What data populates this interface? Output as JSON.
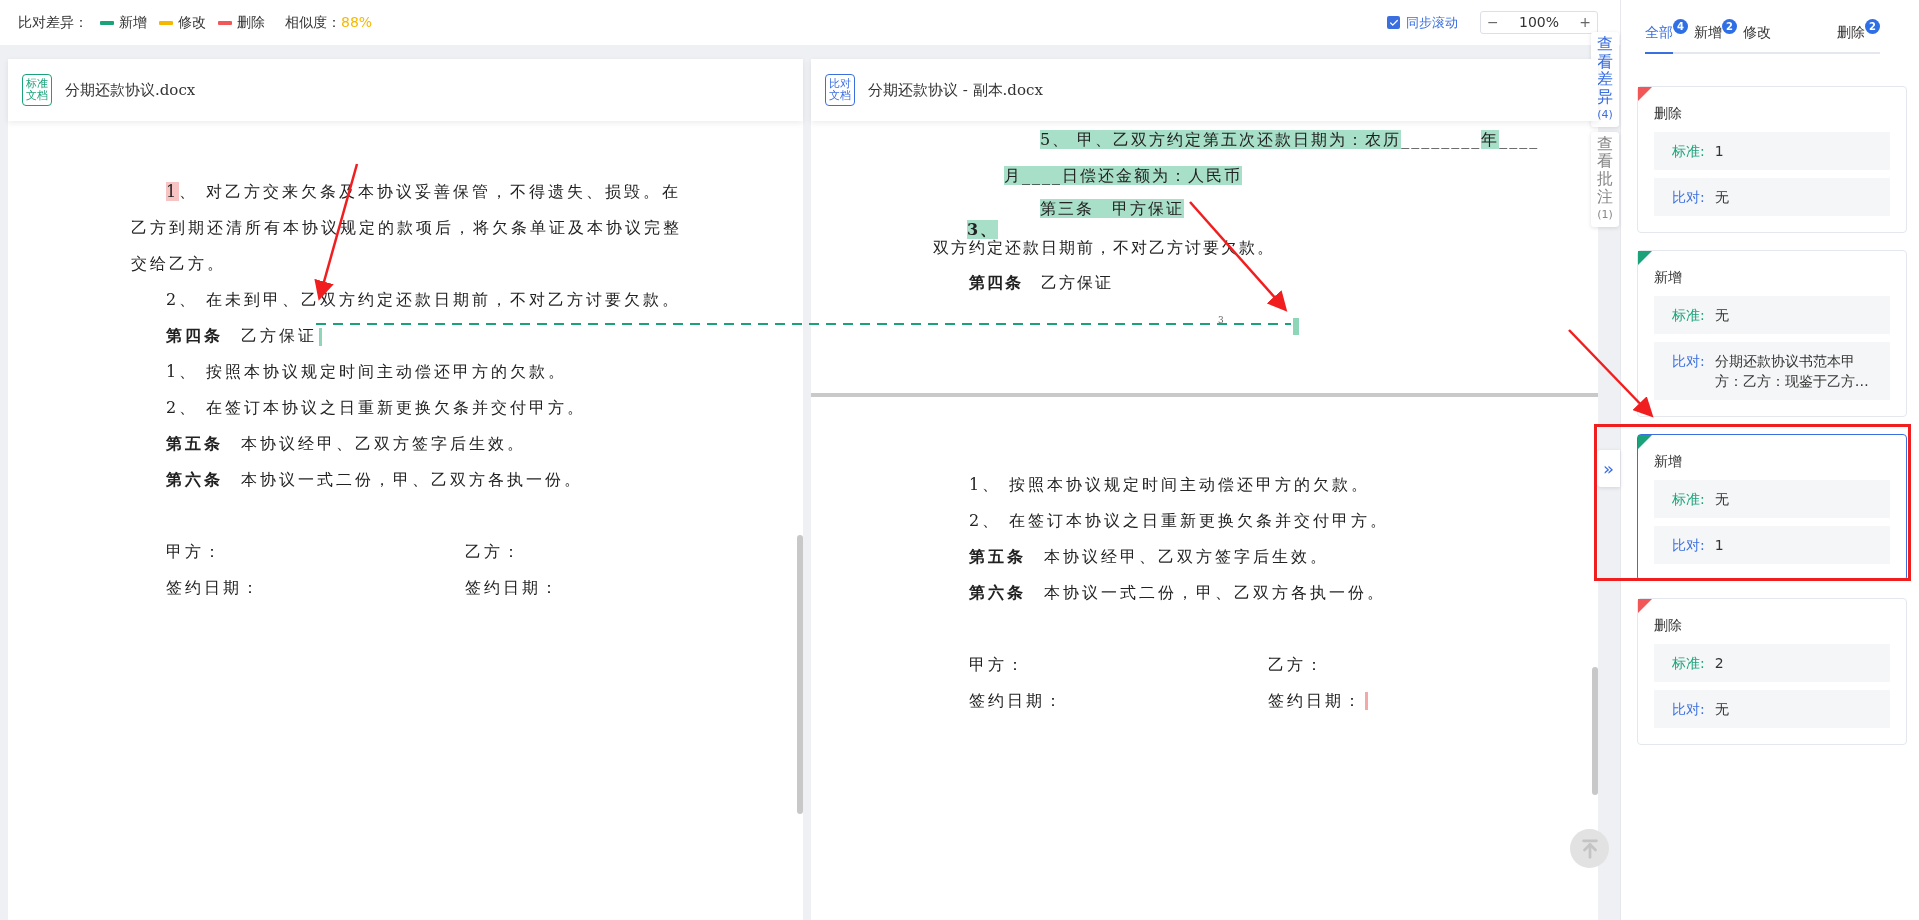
{
  "toolbar": {
    "legend_label": "比对差异：",
    "legend": [
      {
        "label": "新增",
        "color": "#1aa37a"
      },
      {
        "label": "修改",
        "color": "#f5b800"
      },
      {
        "label": "删除",
        "color": "#f25757"
      }
    ],
    "similarity_label": "相似度：",
    "similarity": "88%",
    "sync_scroll": {
      "label": "同步滚动",
      "checked": true
    },
    "zoom": {
      "minus": "−",
      "value": "100%",
      "plus": "+"
    }
  },
  "standard_doc": {
    "badge": [
      "标准",
      "文档"
    ],
    "filename": "分期还款协议.docx",
    "paragraphs": [
      {
        "kind": "item",
        "segments": [
          {
            "text": "1",
            "deleted": true
          },
          {
            "text": "、 对乙方交来欠条及本协议妥善保管，不得遗失、损毁。在乙方到期还清所有本协议规定的款项后，将欠条单证及本协议完整交给乙方。"
          }
        ]
      },
      {
        "kind": "item",
        "segments": [
          {
            "text": "2、 在未到甲、乙双方约定还款日期前，不对乙方讨要欠款。"
          }
        ]
      },
      {
        "kind": "clause",
        "title": "第四条",
        "text": "乙方保证",
        "added_marker": true
      },
      {
        "kind": "item",
        "segments": [
          {
            "text": "1、 按照本协议规定时间主动偿还甲方的欠款。"
          }
        ]
      },
      {
        "kind": "item",
        "segments": [
          {
            "text": "2、 在签订本协议之日重新更换欠条并交付甲方。"
          }
        ]
      },
      {
        "kind": "clause",
        "title": "第五条",
        "text": "本协议经甲、乙双方签字后生效。"
      },
      {
        "kind": "clause",
        "title": "第六条",
        "text": "本协议一式二份，甲、乙双方各执一份。"
      }
    ],
    "signatures": [
      {
        "left": "甲方：",
        "right": "乙方："
      },
      {
        "left": "签约日期：",
        "right": "签约日期："
      }
    ]
  },
  "compare_doc": {
    "badge": [
      "比对",
      "文档"
    ],
    "filename": "分期还款协议 - 副本.docx",
    "diff_lines": [
      {
        "kind": "line",
        "segments": [
          {
            "text": "5、 甲、乙双方约定第五次还款日期为：农历",
            "added": true
          },
          {
            "text": "________"
          },
          {
            "text": "年",
            "added": true
          },
          {
            "text": "____"
          }
        ]
      },
      {
        "kind": "line",
        "segments": [
          {
            "text": "月____日偿还金额为：人民币",
            "added": true
          }
        ]
      },
      {
        "kind": "line",
        "segments": [
          {
            "text": "第三条　甲方保证",
            "added": true
          }
        ]
      },
      {
        "kind": "number",
        "segments": [
          {
            "text": "3、",
            "added": true
          }
        ]
      },
      {
        "kind": "line",
        "segments": [
          {
            "text": "双方约定还款日期前，不对乙方讨要欠款。"
          }
        ]
      },
      {
        "kind": "clause",
        "title": "第四条",
        "text": "乙方保证"
      }
    ],
    "page_mark": "3",
    "added_marker": true,
    "paragraphs": [
      {
        "kind": "item",
        "segments": [
          {
            "text": "1、 按照本协议规定时间主动偿还甲方的欠款。"
          }
        ]
      },
      {
        "kind": "item",
        "segments": [
          {
            "text": "2、 在签订本协议之日重新更换欠条并交付甲方。"
          }
        ]
      },
      {
        "kind": "clause",
        "title": "第五条",
        "text": "本协议经甲、乙双方签字后生效。"
      },
      {
        "kind": "clause",
        "title": "第六条",
        "text": "本协议一式二份，甲、乙双方各执一份。"
      }
    ],
    "signatures": [
      {
        "left": "甲方：",
        "right": "乙方："
      },
      {
        "left": "签约日期：",
        "right": "签约日期：",
        "deleted_marker": true
      }
    ]
  },
  "side_tabs": [
    {
      "label": "查看差异",
      "count": "(4)",
      "selected": true
    },
    {
      "label": "查看批注",
      "count": "(1)",
      "selected": false
    }
  ],
  "expand_button": "»",
  "panel": {
    "tabs": [
      {
        "label": "全部",
        "count": "4",
        "selected": true
      },
      {
        "label": "新增",
        "count": "2",
        "selected": false
      },
      {
        "label": "修改",
        "selected": false
      },
      {
        "label": "删除",
        "count": "2",
        "selected": false
      }
    ],
    "cards": [
      {
        "kind": "deleted",
        "title": "删除",
        "selected": false,
        "rows": [
          {
            "kind": "standard",
            "label": "标准:",
            "value": "1"
          },
          {
            "kind": "compare",
            "label": "比对:",
            "value": "无"
          }
        ]
      },
      {
        "kind": "added",
        "title": "新增",
        "selected": false,
        "rows": [
          {
            "kind": "standard",
            "label": "标准:",
            "value": "无"
          },
          {
            "kind": "compare",
            "label": "比对:",
            "value": "分期还款协议书范本甲方：乙方：现鉴于乙方…"
          }
        ]
      },
      {
        "kind": "added",
        "title": "新增",
        "selected": true,
        "rows": [
          {
            "kind": "standard",
            "label": "标准:",
            "value": "无"
          },
          {
            "kind": "compare",
            "label": "比对:",
            "value": "1"
          }
        ]
      },
      {
        "kind": "deleted",
        "title": "删除",
        "selected": false,
        "rows": [
          {
            "kind": "standard",
            "label": "标准:",
            "value": "2"
          },
          {
            "kind": "compare",
            "label": "比对:",
            "value": "无"
          }
        ]
      }
    ]
  }
}
